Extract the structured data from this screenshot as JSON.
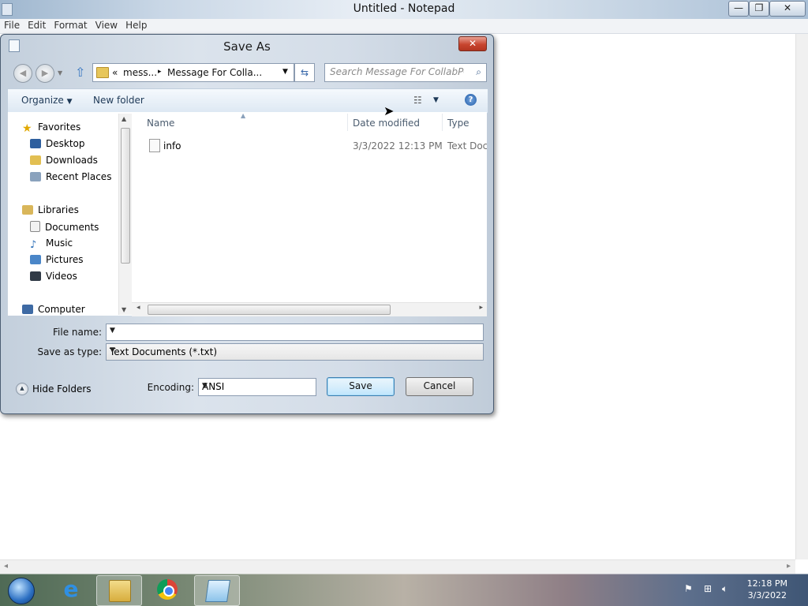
{
  "notepad": {
    "title": "Untitled - Notepad",
    "controls": {
      "minimize": "—",
      "maximize": "❐",
      "close": "✕"
    },
    "menu": [
      "File",
      "Edit",
      "Format",
      "View",
      "Help"
    ]
  },
  "dialog": {
    "title": "Save As",
    "close_glyph": "✕",
    "breadcrumb": {
      "chevrons": "«",
      "parent": "mess...",
      "sep": "▸",
      "current": "Message For Colla..."
    },
    "search_placeholder": "Search Message For CollabPC",
    "toolbar": {
      "organize": "Organize",
      "new_folder": "New folder",
      "help": "?"
    },
    "nav": {
      "favorites": {
        "label": "Favorites",
        "items": [
          "Desktop",
          "Downloads",
          "Recent Places"
        ]
      },
      "libraries": {
        "label": "Libraries",
        "items": [
          "Documents",
          "Music",
          "Pictures",
          "Videos"
        ]
      },
      "computer": "Computer"
    },
    "columns": {
      "name": "Name",
      "date": "Date modified",
      "type": "Type"
    },
    "files": [
      {
        "name": "info",
        "date": "3/3/2022 12:13 PM",
        "type": "Text Docu"
      }
    ],
    "file_name_label": "File name:",
    "file_name_value": "",
    "save_type_label": "Save as type:",
    "save_type_value": "Text Documents (*.txt)",
    "encoding_label": "Encoding:",
    "encoding_value": "ANSI",
    "hide_folders": "Hide Folders",
    "save_button": "Save",
    "cancel_button": "Cancel"
  },
  "taskbar": {
    "apps": [
      "start-orb",
      "internet-explorer",
      "windows-explorer",
      "google-chrome",
      "notepad"
    ],
    "clock_time": "12:18 PM",
    "clock_date": "3/3/2022"
  },
  "colors": {
    "accent": "#3c7fb1",
    "close_red": "#c8452f",
    "dialog_frame": "#c3cfdc"
  }
}
